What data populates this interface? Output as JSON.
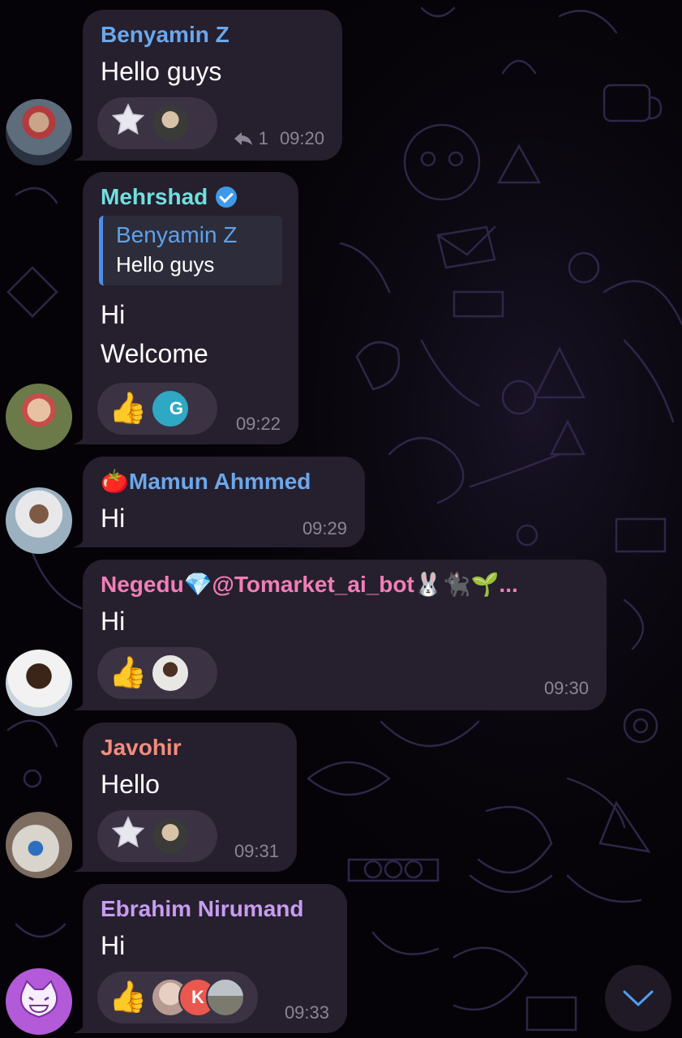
{
  "colors": {
    "background": "#050307",
    "bubble": "#261f2e",
    "reaction_pill": "#3b3343",
    "timestamp": "#8c8595",
    "reply_accent": "#4d8ee6",
    "name_blue": "#6aa8ec",
    "name_teal": "#6fe1de",
    "name_pink": "#f07fb7",
    "name_salmon": "#f28c7e",
    "name_purple": "#c79cf2"
  },
  "messages": [
    {
      "sender": "Benyamin Z",
      "text": "Hello guys",
      "reactions": [
        "star-sticker-emoji",
        "user-avatar"
      ],
      "reply_count": "1",
      "time": "09:20"
    },
    {
      "sender": "Mehrshad",
      "verified": true,
      "reply_to": {
        "sender": "Benyamin Z",
        "text": "Hello guys"
      },
      "text_lines": [
        "Hi",
        "Welcome"
      ],
      "reactions": [
        "👍",
        "user-avatar-g"
      ],
      "reaction_avatar_letter": "G",
      "time": "09:22"
    },
    {
      "sender_prefix": "🍅",
      "sender": "Mamun Ahmmed",
      "text": "Hi",
      "time": "09:29"
    },
    {
      "sender": "Negedu💎@Tomarket_ai_bot🐰🐈‍⬛🌱...",
      "text": "Hi",
      "reactions": [
        "👍",
        "user-avatar"
      ],
      "time": "09:30"
    },
    {
      "sender": "Javohir",
      "text": "Hello",
      "reactions": [
        "star-sticker-emoji",
        "user-avatar"
      ],
      "time": "09:31"
    },
    {
      "sender": "Ebrahim Nirumand",
      "text": "Hi",
      "reactions": [
        "👍",
        "user-avatar",
        "user-avatar-k",
        "user-avatar"
      ],
      "reaction_avatar_letter": "K",
      "time": "09:33"
    }
  ],
  "thumbs_up": "👍",
  "scroll_button_icon": "chevron-down-icon"
}
